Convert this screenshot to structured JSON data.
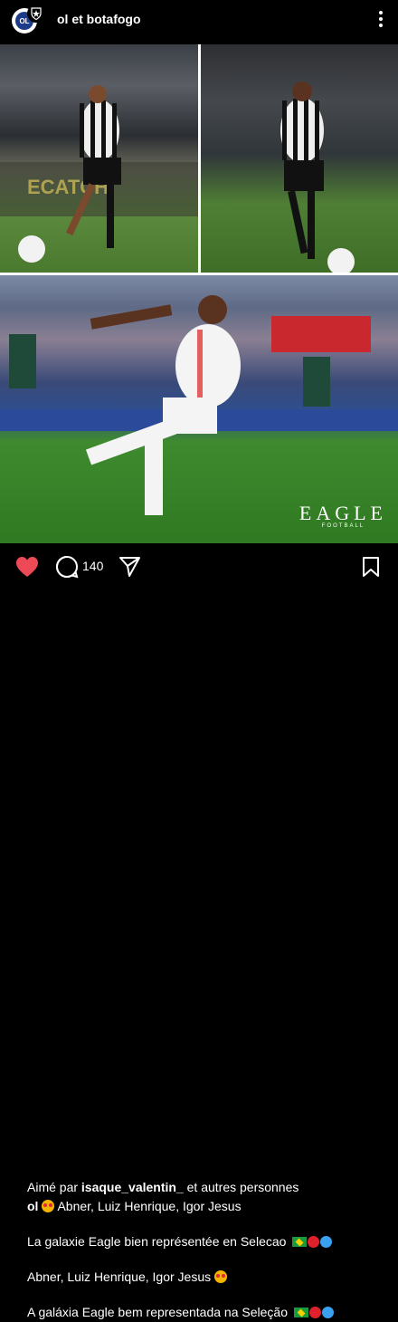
{
  "post": {
    "username": "ol et botafogo",
    "avatar_label": "OL"
  },
  "photos": {
    "watermark_main": "EAGLE",
    "watermark_sub": "FOOTBALL"
  },
  "actions": {
    "like_count": "140",
    "comment_count": "140"
  },
  "caption": {
    "liked_prefix": "Aimé par ",
    "liked_user": "isaque_valentin_",
    "liked_suffix": " et autres personnes",
    "author": "ol",
    "author_text": " Abner, Luiz Henrique, Igor Jesus",
    "line_fr": "La galaxie Eagle bien représentée en Selecao",
    "line_names": "Abner, Luiz Henrique, Igor Jesus",
    "line_pt": "A galáxia Eagle bem representada na Seleção"
  },
  "colors": {
    "heart": "#ed4956",
    "background": "#000000"
  }
}
